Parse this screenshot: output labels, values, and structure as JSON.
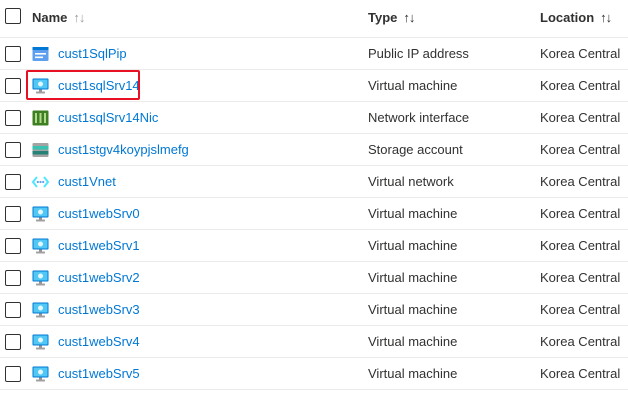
{
  "header": {
    "name_label": "Name",
    "type_label": "Type",
    "location_label": "Location",
    "sort_glyph": "↑↓"
  },
  "rows": [
    {
      "name": "cust1SqlPip",
      "type": "Public IP address",
      "location": "Korea Central",
      "icon": "public-ip-icon"
    },
    {
      "name": "cust1sqlSrv14",
      "type": "Virtual machine",
      "location": "Korea Central",
      "icon": "virtual-machine-icon",
      "highlighted": true
    },
    {
      "name": "cust1sqlSrv14Nic",
      "type": "Network interface",
      "location": "Korea Central",
      "icon": "network-interface-icon"
    },
    {
      "name": "cust1stgv4koypjslmefg",
      "type": "Storage account",
      "location": "Korea Central",
      "icon": "storage-account-icon"
    },
    {
      "name": "cust1Vnet",
      "type": "Virtual network",
      "location": "Korea Central",
      "icon": "virtual-network-icon"
    },
    {
      "name": "cust1webSrv0",
      "type": "Virtual machine",
      "location": "Korea Central",
      "icon": "virtual-machine-icon"
    },
    {
      "name": "cust1webSrv1",
      "type": "Virtual machine",
      "location": "Korea Central",
      "icon": "virtual-machine-icon"
    },
    {
      "name": "cust1webSrv2",
      "type": "Virtual machine",
      "location": "Korea Central",
      "icon": "virtual-machine-icon"
    },
    {
      "name": "cust1webSrv3",
      "type": "Virtual machine",
      "location": "Korea Central",
      "icon": "virtual-machine-icon"
    },
    {
      "name": "cust1webSrv4",
      "type": "Virtual machine",
      "location": "Korea Central",
      "icon": "virtual-machine-icon"
    },
    {
      "name": "cust1webSrv5",
      "type": "Virtual machine",
      "location": "Korea Central",
      "icon": "virtual-machine-icon"
    }
  ],
  "colors": {
    "link": "#0078d4",
    "highlight_border": "#e81123",
    "row_divider": "#edebe9"
  }
}
